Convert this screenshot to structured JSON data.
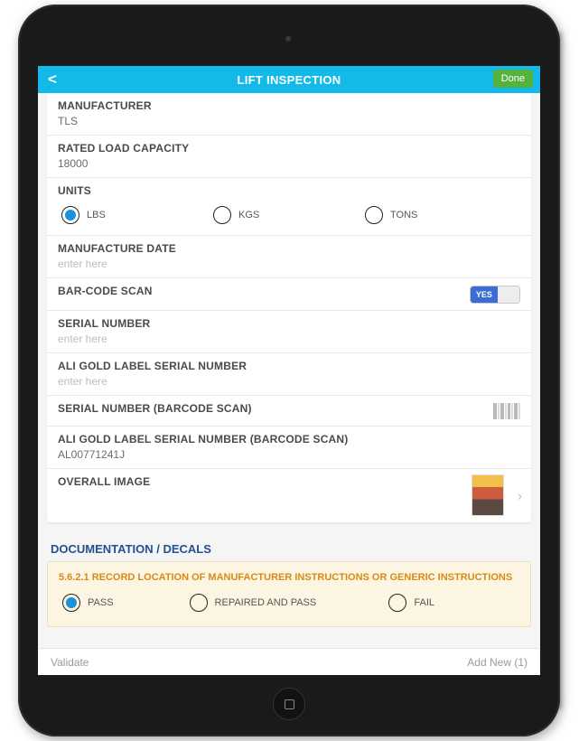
{
  "header": {
    "back_glyph": "<",
    "title": "LIFT INSPECTION",
    "done_label": "Done"
  },
  "fields": {
    "manufacturer": {
      "label": "MANUFACTURER",
      "value": "TLS"
    },
    "rated_load": {
      "label": "RATED LOAD CAPACITY",
      "value": "18000"
    },
    "units": {
      "label": "UNITS",
      "options": [
        "LBS",
        "KGS",
        "TONS"
      ],
      "selected": "LBS"
    },
    "manuf_date": {
      "label": "MANUFACTURE DATE",
      "placeholder": "enter here",
      "value": ""
    },
    "barcode_scan": {
      "label": "BAR-CODE SCAN",
      "toggle_on_text": "YES",
      "toggle_state": true
    },
    "serial": {
      "label": "SERIAL NUMBER",
      "placeholder": "enter here",
      "value": ""
    },
    "ali_serial": {
      "label": "ALI GOLD LABEL SERIAL NUMBER",
      "placeholder": "enter here",
      "value": ""
    },
    "serial_bc": {
      "label": "SERIAL NUMBER (BARCODE SCAN)"
    },
    "ali_serial_bc": {
      "label": "ALI GOLD LABEL SERIAL NUMBER (BARCODE SCAN)",
      "value": "AL00771241J"
    },
    "overall_image": {
      "label": "OVERALL IMAGE"
    }
  },
  "section2": {
    "title": "DOCUMENTATION / DECALS",
    "question": "5.6.2.1 RECORD LOCATION OF MANUFACTURER INSTRUCTIONS OR GENERIC INSTRUCTIONS",
    "options": [
      "PASS",
      "REPAIRED AND PASS",
      "FAIL"
    ],
    "selected": "PASS"
  },
  "footer": {
    "validate": "Validate",
    "addnew": "Add New (1)"
  }
}
